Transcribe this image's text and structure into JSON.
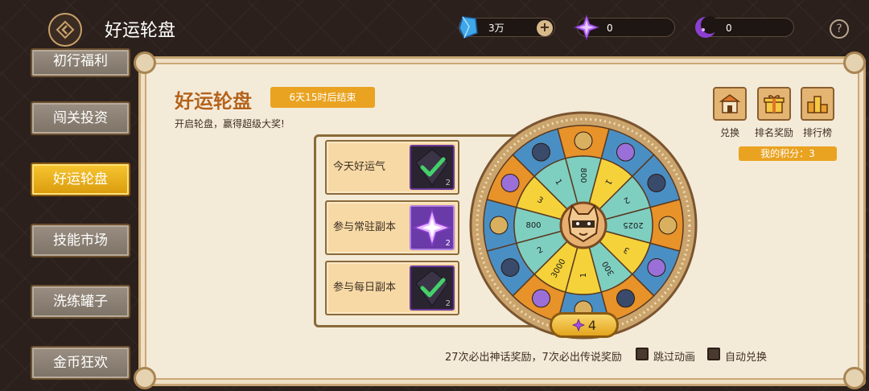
{
  "header": {
    "title": "好运轮盘",
    "resources": [
      {
        "icon": "blue-crystal-icon",
        "value": "3万",
        "has_plus": true
      },
      {
        "icon": "purple-star-icon",
        "value": "0"
      },
      {
        "icon": "crescent-moon-icon",
        "value": "0"
      }
    ],
    "help": "?"
  },
  "sidebar": {
    "items": [
      {
        "label": "初行福利",
        "active": false
      },
      {
        "label": "闯关投资",
        "active": false
      },
      {
        "label": "好运轮盘",
        "active": true
      },
      {
        "label": "技能市场",
        "active": false
      },
      {
        "label": "洗练罐子",
        "active": false
      },
      {
        "label": "金币狂欢",
        "active": false
      }
    ]
  },
  "event": {
    "title": "好运轮盘",
    "timer": "6天15时后结束",
    "description": "开启轮盘，赢得超级大奖!",
    "buttons": [
      {
        "label": "兑换",
        "icon": "shop-icon"
      },
      {
        "label": "排名奖励",
        "icon": "gift-icon"
      },
      {
        "label": "排行榜",
        "icon": "podium-icon"
      }
    ],
    "score": "我的积分：3"
  },
  "tasks": [
    {
      "label": "今天好运气",
      "count": "2",
      "status": "done"
    },
    {
      "label": "参与常驻副本",
      "count": "2",
      "status": "reward"
    },
    {
      "label": "参与每日副本",
      "count": "2",
      "status": "done"
    }
  ],
  "wheel": {
    "inner_labels": [
      "800",
      "1",
      "2",
      "2025",
      "3",
      "300",
      "1",
      "3000",
      "2",
      "800",
      "3",
      "1"
    ],
    "spin_cost": "4",
    "colors": {
      "orange": "#e8922a",
      "blue": "#4a8fc4",
      "teal": "#7fcfc0",
      "yellow": "#f5d23a",
      "rim": "#c8a068"
    }
  },
  "footer": {
    "guarantee": "27次必出神话奖励，7次必出传说奖励",
    "options": [
      {
        "label": "跳过动画",
        "checked": false
      },
      {
        "label": "自动兑换",
        "checked": false
      }
    ]
  }
}
